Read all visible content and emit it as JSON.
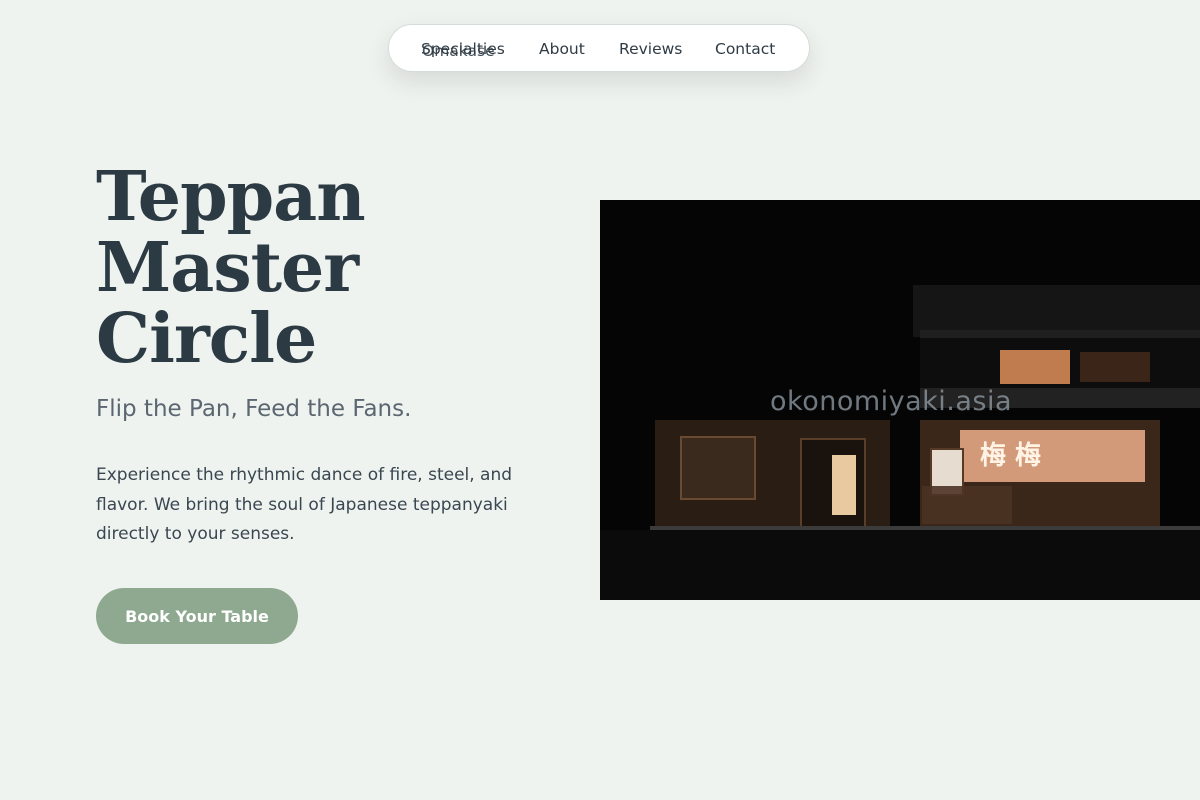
{
  "nav": {
    "links": [
      {
        "label": "Specialties"
      },
      {
        "label": "Omakase"
      },
      {
        "label": "About"
      },
      {
        "label": "Reviews"
      },
      {
        "label": "Contact"
      }
    ]
  },
  "hero": {
    "title_lines": [
      "Teppan",
      "Master",
      "Circle"
    ],
    "tagline": "Flip the Pan, Feed the Fans.",
    "description": "Experience the rhythmic dance of fire, steel, and flavor. We bring the soul of Japanese teppanyaki directly to your senses.",
    "cta_label": "Book Your Table"
  },
  "image": {
    "watermark": "okonomiyaki.asia",
    "noren_text": "梅 梅"
  },
  "colors": {
    "background": "#eff3f0",
    "text": "#2c3a44",
    "accent": "#8ea98f",
    "nav_bg": "#ffffff"
  }
}
